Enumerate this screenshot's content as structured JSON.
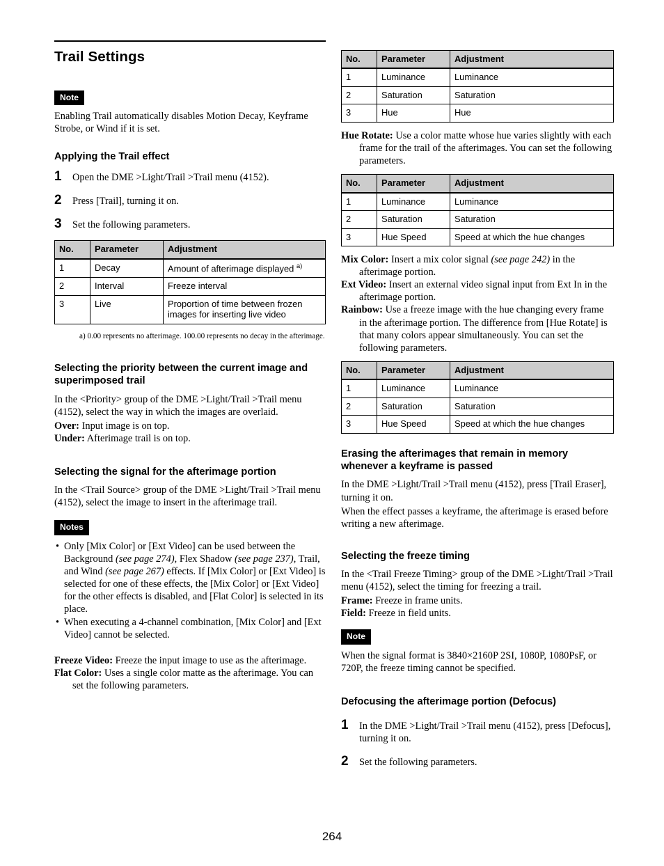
{
  "page_number": "264",
  "left_column": {
    "title": "Trail Settings",
    "note_badge": "Note",
    "note_text": "Enabling Trail automatically disables Motion Decay, Keyframe Strobe, or Wind if it is set.",
    "applying_heading": "Applying the Trail effect",
    "steps": [
      {
        "num": "1",
        "text": "Open the DME >Light/Trail >Trail menu (4152)."
      },
      {
        "num": "2",
        "text": "Press [Trail], turning it on."
      },
      {
        "num": "3",
        "text": "Set the following parameters."
      }
    ],
    "table_decay": {
      "headers": [
        "No.",
        "Parameter",
        "Adjustment"
      ],
      "rows": [
        [
          "1",
          "Decay",
          "Amount of afterimage displayed",
          "a)"
        ],
        [
          "2",
          "Interval",
          "Freeze interval",
          ""
        ],
        [
          "3",
          "Live",
          "Proportion of time between frozen images for inserting live video",
          ""
        ]
      ]
    },
    "footnote": "a) 0.00 represents no afterimage. 100.00 represents no decay in the afterimage.",
    "priority_heading": "Selecting the priority between the current image and superimposed trail",
    "priority_text": "In the <Priority> group of the DME >Light/Trail >Trail menu (4152), select the way in which the images are overlaid.",
    "priority_defs": [
      {
        "term": "Over:",
        "text": "Input image is on top."
      },
      {
        "term": "Under:",
        "text": "Afterimage trail is on top."
      }
    ],
    "signal_heading": "Selecting the signal for the afterimage portion",
    "signal_text": "In the <Trail Source> group of the DME >Light/Trail >Trail menu (4152), select the image to insert in the afterimage trail.",
    "notes_badge": "Notes",
    "notes_bullets": [
      {
        "parts": [
          {
            "t": "Only [Mix Color] or [Ext Video] can be used between the Background ",
            "i": false
          },
          {
            "t": "(see page 274)",
            "i": true
          },
          {
            "t": ", Flex Shadow ",
            "i": false
          },
          {
            "t": "(see page 237)",
            "i": true
          },
          {
            "t": ", Trail, and Wind ",
            "i": false
          },
          {
            "t": "(see page 267)",
            "i": true
          },
          {
            "t": " effects. If [Mix Color] or [Ext Video] is selected for one of these effects, the [Mix Color] or [Ext Video] for the other effects is disabled, and [Flat Color] is selected in its place.",
            "i": false
          }
        ]
      },
      {
        "parts": [
          {
            "t": "When executing a 4-channel combination, [Mix Color] and [Ext Video] cannot be selected.",
            "i": false
          }
        ]
      }
    ],
    "source_defs": [
      {
        "term": "Freeze Video:",
        "text": "Freeze the input image to use as the afterimage."
      },
      {
        "term": "Flat Color:",
        "text": "Uses a single color matte as the afterimage. You can set the following parameters."
      }
    ]
  },
  "right_column": {
    "table_flat_color": {
      "headers": [
        "No.",
        "Parameter",
        "Adjustment"
      ],
      "rows": [
        [
          "1",
          "Luminance",
          "Luminance"
        ],
        [
          "2",
          "Saturation",
          "Saturation"
        ],
        [
          "3",
          "Hue",
          "Hue"
        ]
      ]
    },
    "hue_rotate": {
      "term": "Hue Rotate:",
      "text": "Use a color matte whose hue varies slightly with each frame for the trail of the afterimages. You can set the following parameters."
    },
    "table_hue_rotate": {
      "headers": [
        "No.",
        "Parameter",
        "Adjustment"
      ],
      "rows": [
        [
          "1",
          "Luminance",
          "Luminance"
        ],
        [
          "2",
          "Saturation",
          "Saturation"
        ],
        [
          "3",
          "Hue Speed",
          "Speed at which the hue changes"
        ]
      ]
    },
    "mix_color": {
      "term": "Mix Color:",
      "parts": [
        {
          "t": "Insert a mix color signal ",
          "i": false
        },
        {
          "t": "(see page 242)",
          "i": true
        },
        {
          "t": " in the afterimage portion.",
          "i": false
        }
      ]
    },
    "ext_video": {
      "term": "Ext Video:",
      "text": "Insert an external video signal input from Ext In in the afterimage portion."
    },
    "rainbow": {
      "term": "Rainbow:",
      "text": "Use a freeze image with the hue changing every frame in the afterimage portion. The difference from [Hue Rotate] is that many colors appear simultaneously. You can set the following parameters."
    },
    "table_rainbow": {
      "headers": [
        "No.",
        "Parameter",
        "Adjustment"
      ],
      "rows": [
        [
          "1",
          "Luminance",
          "Luminance"
        ],
        [
          "2",
          "Saturation",
          "Saturation"
        ],
        [
          "3",
          "Hue Speed",
          "Speed at which the hue changes"
        ]
      ]
    },
    "erasing_heading": "Erasing the afterimages that remain in memory whenever a keyframe is passed",
    "erasing_text_1": "In the DME >Light/Trail >Trail menu (4152), press [Trail Eraser], turning it on.",
    "erasing_text_2": "When the effect passes a keyframe, the afterimage is erased before writing a new afterimage.",
    "freeze_timing_heading": "Selecting the freeze timing",
    "freeze_timing_text": "In the <Trail Freeze Timing> group of the DME >Light/Trail >Trail menu (4152), select the timing for freezing a trail.",
    "freeze_timing_defs": [
      {
        "term": "Frame:",
        "text": "Freeze in frame units."
      },
      {
        "term": "Field:",
        "text": "Freeze in field units."
      }
    ],
    "note_badge": "Note",
    "note_text": "When the signal format is 3840×2160P 2SI, 1080P, 1080PsF, or 720P, the freeze timing cannot be specified.",
    "defocus_heading": "Defocusing the afterimage portion (Defocus)",
    "defocus_steps": [
      {
        "num": "1",
        "text": "In the DME >Light/Trail >Trail menu (4152), press [Defocus], turning it on."
      },
      {
        "num": "2",
        "text": "Set the following parameters."
      }
    ]
  }
}
